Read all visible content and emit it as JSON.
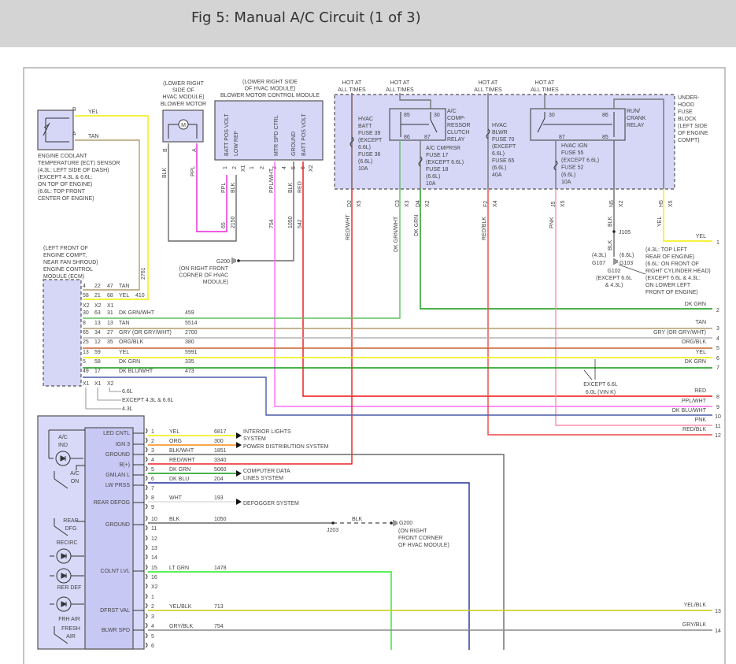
{
  "title": "Fig 5: Manual A/C Circuit (1 of 3)",
  "colors": {
    "YEL": "#f2ee00",
    "TAN": "#b39b6e",
    "GRY": "#b4b4b4",
    "ORG_BLK": "#c5642e",
    "DK_GRN": "#119911",
    "DK_GRN_WHT": "#5fbf5f",
    "DK_BLU_WHT": "#4a5aa8",
    "RED": "#ee1111",
    "PPL_WHT": "#ff6cf0",
    "PPL": "#ee22dd",
    "PNK": "#ff8fa8",
    "RED_BLK": "#ee4848",
    "RED_WHT": "#ee2020",
    "BLK": "#6a6a6a",
    "DK_BLU": "#1e2e9e",
    "LT_GRN": "#22ee22",
    "YEL_BLK": "#caca10",
    "GRY_BLK": "#8a8a8a",
    "ORG": "#ff8a10",
    "WHT": "#dddddd",
    "component_fill": "#d6d6f7"
  },
  "ect": {
    "pins": [
      "B",
      "A"
    ],
    "wires": [
      "YEL",
      "TAN"
    ],
    "circuit": "2761",
    "label": [
      "ENGINE COOLANT",
      "TEMPERATURE (ECT) SENSOR",
      "(4.3L: LEFT SIDE OF DASH)",
      "(EXCEPT 4.3L & 6.6L:",
      "ON TOP OF ENGINE)",
      "(6.6L: TOP FRONT",
      "CENTER OF ENGINE)"
    ]
  },
  "blower_motor": {
    "label": [
      "(LOWER RIGHT",
      "SIDE OF",
      "HVAC MODULE)",
      "BLOWER MOTOR"
    ],
    "symbol": "M",
    "pins": [
      "B",
      "A"
    ],
    "wires": [
      "BLK",
      "PPL"
    ]
  },
  "bmcm": {
    "label": [
      "(LOWER RIGHT SIDE",
      "OF HVAC MODULE)",
      "BLOWER MOTOR CONTROL MODULE"
    ],
    "pin_labels": [
      "BATT POS VOLT",
      "LOW REF",
      "MTR SPD CTRL",
      "GROUND",
      "BATT POS VOLT"
    ],
    "x1_pins": [
      "1",
      "2"
    ],
    "x2_pins": [
      "1",
      "2",
      "3",
      "4",
      "5",
      "6"
    ],
    "connectors": [
      "X1",
      "X2"
    ],
    "wires": [
      "PPL",
      "BLK",
      "PPL/WHT",
      "BLK",
      "RED"
    ],
    "circuits": [
      "65",
      "2150",
      "754",
      "1050",
      "542"
    ]
  },
  "g200_top": {
    "name": "G200",
    "label": [
      "(ON RIGHT FRONT",
      "CORNER OF HVAC",
      "MODULE)"
    ]
  },
  "fuse_block": {
    "hot": [
      "HOT AT",
      "ALL TIMES"
    ],
    "label": [
      "UNDER-",
      "HOOD",
      "FUSE",
      "BLOCK",
      "(LEFT SIDE",
      "OF ENGINE",
      "COMPT)"
    ],
    "hvac_batt": [
      "HVAC",
      "BATT",
      "FUSE 39",
      "(EXCEPT",
      "6.6L)",
      "FUSE 36",
      "(6.6L)",
      "10A"
    ],
    "ac_cmprsr": [
      "A/C CMPRSR",
      "FUSE 17",
      "(EXCEPT 6.6L)",
      "FUSE 18",
      "(6.6L)",
      "10A"
    ],
    "ac_relay": [
      "A/C",
      "COMP-",
      "RESSOR",
      "CLUTCH",
      "RELAY"
    ],
    "ac_relay_pins": [
      "85",
      "30",
      "86",
      "87"
    ],
    "hvac_blwr": [
      "HVAC",
      "BLWR",
      "FUSE 70",
      "(EXCEPT",
      "6.6L)",
      "FUSE 65",
      "(6.6L)",
      "40A"
    ],
    "hvac_ign": [
      "HVAC IGN",
      "FUSE 55",
      "(EXCEPT 6.6L)",
      "FUSE 52",
      "(6.6L)",
      "10A"
    ],
    "run_relay": [
      "RUN/",
      "CRANK",
      "RELAY"
    ],
    "run_relay_pins": [
      "30",
      "86",
      "87",
      "85"
    ],
    "cavities": [
      [
        "D2",
        "X5"
      ],
      [
        "C3",
        "X3"
      ],
      [
        "D4",
        "X2"
      ],
      [
        "F2",
        "X4"
      ],
      [
        "J5",
        "X5"
      ],
      [
        "N5",
        "X2"
      ],
      [
        "H5",
        "X5"
      ]
    ],
    "wires": [
      "RED/WHT",
      "DK GRN/WHT",
      "DK GRN",
      "RED/BLK",
      "PNK",
      "BLK",
      "YEL"
    ]
  },
  "ground_splice": {
    "splice": "J105",
    "wire": "BLK",
    "left": [
      "(4.3L)",
      "G107"
    ],
    "right": [
      "(6.6L)",
      "G103"
    ],
    "center": [
      "G102",
      "(EXCEPT 6.6L",
      "& 4.3L)"
    ],
    "note": [
      "(4.3L: TOP LEFT",
      "REAR OF ENGINE)",
      "(6.6L: ON FRONT OF",
      "RIGHT CYLINDER HEAD)",
      "(EXCEPT 6.6L & 4.3L:",
      "ON LOWER LEFT",
      "FRONT OF ENGINE)"
    ]
  },
  "ecm": {
    "label": [
      "(LEFT FRONT OF",
      "ENGINE COMPT,",
      "NEAR FAN SHROUD)",
      "ENGINE CONTROL",
      "MODULE (ECM)"
    ],
    "top_rows": [
      [
        "4",
        "22",
        "47",
        "TAN",
        ""
      ],
      [
        "58",
        "21",
        "68",
        "YEL",
        "410"
      ]
    ],
    "top_connectors": [
      "X2",
      "X2",
      "X1"
    ],
    "rows": [
      [
        "30",
        "63",
        "31",
        "DK GRN/WHT",
        "459"
      ],
      [
        "8",
        "13",
        "13",
        "TAN",
        "5514"
      ],
      [
        "65",
        "34",
        "27",
        "GRY (OR GRY/WHT)",
        "2700"
      ],
      [
        "25",
        "12",
        "35",
        "ORG/BLK",
        "380"
      ],
      [
        "13",
        "59",
        "",
        "YEL",
        "5991"
      ],
      [
        "5",
        "58",
        "",
        "DK GRN",
        "335"
      ],
      [
        "49",
        "17",
        "",
        "DK BLU/WHT",
        "473"
      ]
    ],
    "bottom_connectors": [
      "X1",
      "X1",
      "X2"
    ],
    "notes": [
      "6.6L",
      "EXCEPT 4.3L & 6.6L",
      "4.3L"
    ]
  },
  "except_note": [
    "EXCEPT 6.6L",
    "6.0L (VIN K)"
  ],
  "right_rows": [
    {
      "label": "YEL",
      "num": "1"
    },
    {
      "label": "DK GRN",
      "num": "2"
    },
    {
      "label": "TAN",
      "num": "3"
    },
    {
      "label": "GRY     (OR GRY/WHT)",
      "num": "4"
    },
    {
      "label": "ORG/BLK",
      "num": "5"
    },
    {
      "label": "YEL",
      "num": "6"
    },
    {
      "label": "DK GRN",
      "num": "7"
    },
    {
      "label": "RED",
      "num": "8"
    },
    {
      "label": "PPL/WHT",
      "num": "9"
    },
    {
      "label": "DK BLU/WHT",
      "num": "10"
    },
    {
      "label": "PNK",
      "num": "11"
    },
    {
      "label": "RED/BLK",
      "num": "12"
    },
    {
      "label": "YEL/BLK",
      "num": "13"
    },
    {
      "label": "GRY/BLK",
      "num": "14"
    }
  ],
  "hvac_control": {
    "switch_labels": [
      [
        "A/C",
        "IND"
      ],
      [
        "A/C",
        "ON"
      ],
      [
        "REAR",
        "DFG"
      ],
      [
        "RECIRC"
      ],
      [
        "RER DEF"
      ],
      [
        "FRH AIR"
      ],
      [
        "FRESH",
        "AIR"
      ]
    ],
    "pin_functions": [
      "LED CNTL",
      "IGN 3",
      "GROUND",
      "B(+)",
      "GMLAN L",
      "LW PRSS",
      "REAR DEFOG",
      "GROUND",
      "COLNT LVL",
      "DFRST VAL",
      "BLWR SPD"
    ],
    "pins": [
      [
        "1",
        "YEL",
        "6817"
      ],
      [
        "2",
        "ORG",
        "300"
      ],
      [
        "3",
        "BLK/WHT",
        "1851"
      ],
      [
        "4",
        "RED/WHT",
        "3340"
      ],
      [
        "5",
        "DK GRN",
        "5060"
      ],
      [
        "6",
        "DK BLU",
        "204"
      ],
      [
        "7",
        "",
        ""
      ],
      [
        "8",
        "WHT",
        "193"
      ],
      [
        "9",
        "",
        ""
      ],
      [
        "10",
        "BLK",
        "1050"
      ],
      [
        "11",
        "",
        ""
      ],
      [
        "12",
        "",
        ""
      ],
      [
        "13",
        "",
        ""
      ],
      [
        "14",
        "",
        ""
      ],
      [
        "15",
        "LT GRN",
        "1478"
      ],
      [
        "16",
        "",
        ""
      ],
      [
        "X2",
        "",
        ""
      ],
      [
        "1",
        "",
        ""
      ],
      [
        "2",
        "YEL/BLK",
        "713"
      ],
      [
        "3",
        "",
        ""
      ],
      [
        "4",
        "GRY/BLK",
        "754"
      ],
      [
        "5",
        "",
        ""
      ],
      [
        "6",
        "",
        ""
      ]
    ],
    "destinations": [
      "INTERIOR LIGHTS",
      "SYSTEM",
      "POWER DISTRIBUTION SYSTEM",
      "COMPUTER DATA",
      "LINES SYSTEM",
      "DEFOGGER SYSTEM"
    ],
    "j203": "J203",
    "ground_wire": "BLK",
    "g200": "G200",
    "g200_label": [
      "(ON RIGHT",
      "FRONT CORNER",
      "OF HVAC MODULE)"
    ]
  }
}
